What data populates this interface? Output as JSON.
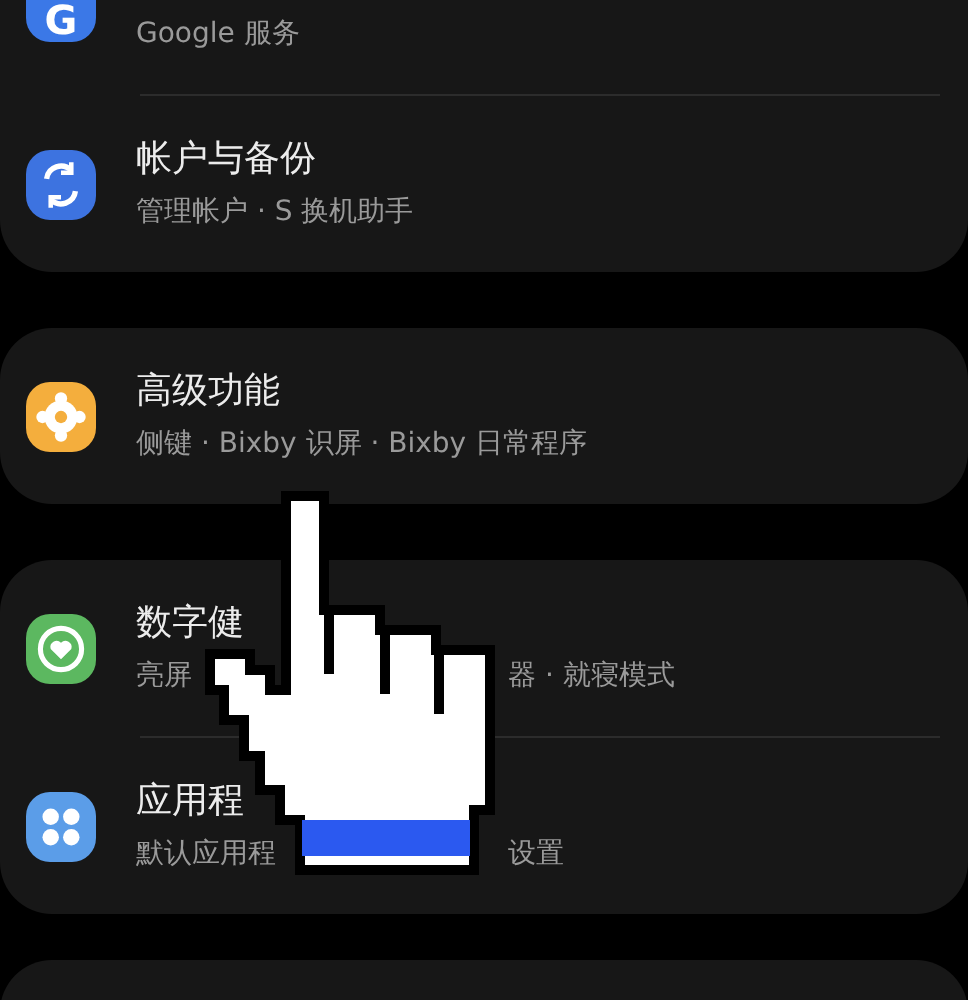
{
  "cards": [
    {
      "rows": [
        {
          "kind": "google",
          "icon_text": "G",
          "color": "#3b78e7",
          "subtitle_parts": [
            "Google 服务"
          ]
        },
        {
          "kind": "sync",
          "color": "#3d73e0",
          "title": "帐户与备份",
          "subtitle_parts": [
            "管理帐户 · S 换机助手"
          ]
        }
      ]
    },
    {
      "rows": [
        {
          "kind": "gear",
          "color": "#f4ae3d",
          "title": "高级功能",
          "subtitle_parts": [
            "侧键 · Bixby 识屏 · Bixby 日常程序"
          ]
        }
      ]
    },
    {
      "rows": [
        {
          "kind": "heart",
          "color": "#5cb860",
          "title": "数字健",
          "subtitle_parts": [
            "亮屏",
            "器 · 就寝模式"
          ]
        },
        {
          "kind": "dots",
          "color": "#5b9de8",
          "title": "应用程",
          "subtitle_parts": [
            "默认应用程",
            "设置"
          ]
        }
      ]
    }
  ]
}
